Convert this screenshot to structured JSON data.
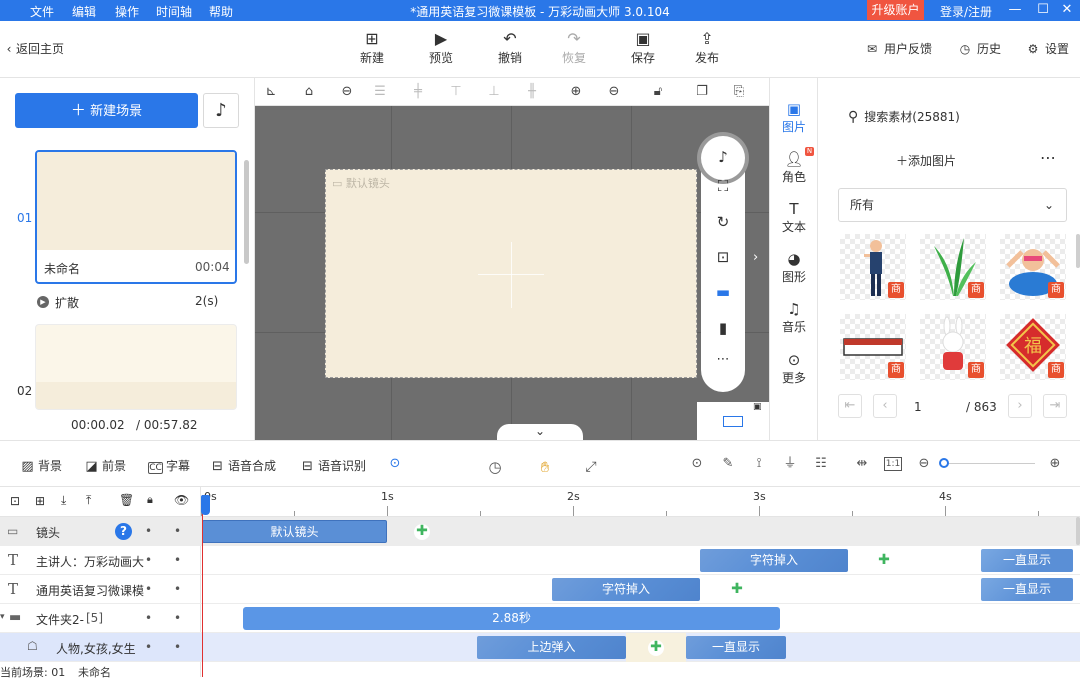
{
  "window": {
    "menu": [
      "文件",
      "编辑",
      "操作",
      "时间轴",
      "帮助"
    ],
    "title": "*通用英语复习微课模板 - 万彩动画大师 3.0.104",
    "upgrade_label": "升级账户",
    "login_label": "登录/注册",
    "controls": [
      "—",
      "☐",
      "✕"
    ]
  },
  "toolbar": {
    "back_label": "返回主页",
    "new_label": "新建",
    "preview_label": "预览",
    "undo_label": "撤销",
    "redo_label": "恢复",
    "save_label": "保存",
    "publish_label": "发布",
    "feedback_label": "用户反馈",
    "history_label": "历史",
    "settings_label": "设置"
  },
  "scenes": {
    "new_scene_label": "新建场景",
    "items": [
      {
        "number": "01",
        "name": "未命名",
        "duration": "00:04",
        "transition": "扩散",
        "transition_duration": "2(s)"
      },
      {
        "number": "02"
      }
    ],
    "current_time": "00:00.02",
    "total_time": "/ 00:57.82"
  },
  "canvas": {
    "stage_label": "默认镜头",
    "bg_color": "#f5eddb"
  },
  "side_tabs": {
    "image": "图片",
    "role": "角色",
    "text": "文本",
    "shape": "图形",
    "music": "音乐",
    "more": "更多",
    "role_badge": "N"
  },
  "assets": {
    "search_label": "搜索素材(25881)",
    "add_label": "添加图片",
    "filter_value": "所有",
    "badge": "商",
    "page_current": "1",
    "page_total": "/ 863"
  },
  "timeline_toolbar": {
    "background": "背景",
    "foreground": "前景",
    "subtitle": "字幕",
    "tts": "语音合成",
    "asr": "语音识别"
  },
  "timeline": {
    "ruler": [
      "0s",
      "1s",
      "2s",
      "3s",
      "4s"
    ],
    "tracks": [
      {
        "name": "镜头"
      },
      {
        "name": "主讲人：万彩动画大"
      },
      {
        "name": "通用英语复习微课模"
      },
      {
        "name": "文件夹2-",
        "count": "[5]"
      },
      {
        "name": "人物,女孩,女生"
      }
    ],
    "clips": {
      "camera_default": "默认镜头",
      "char_drop": "字符掉入",
      "always_show": "一直显示",
      "folder_duration": "2.88秒",
      "top_popin": "上边弹入"
    },
    "status_label": "当前场景: 01",
    "status_name": "未命名"
  },
  "colors": {
    "accent": "#2a77e8",
    "upgrade": "#f05540",
    "clip": "#5a8fd6",
    "playhead": "#e03030"
  }
}
